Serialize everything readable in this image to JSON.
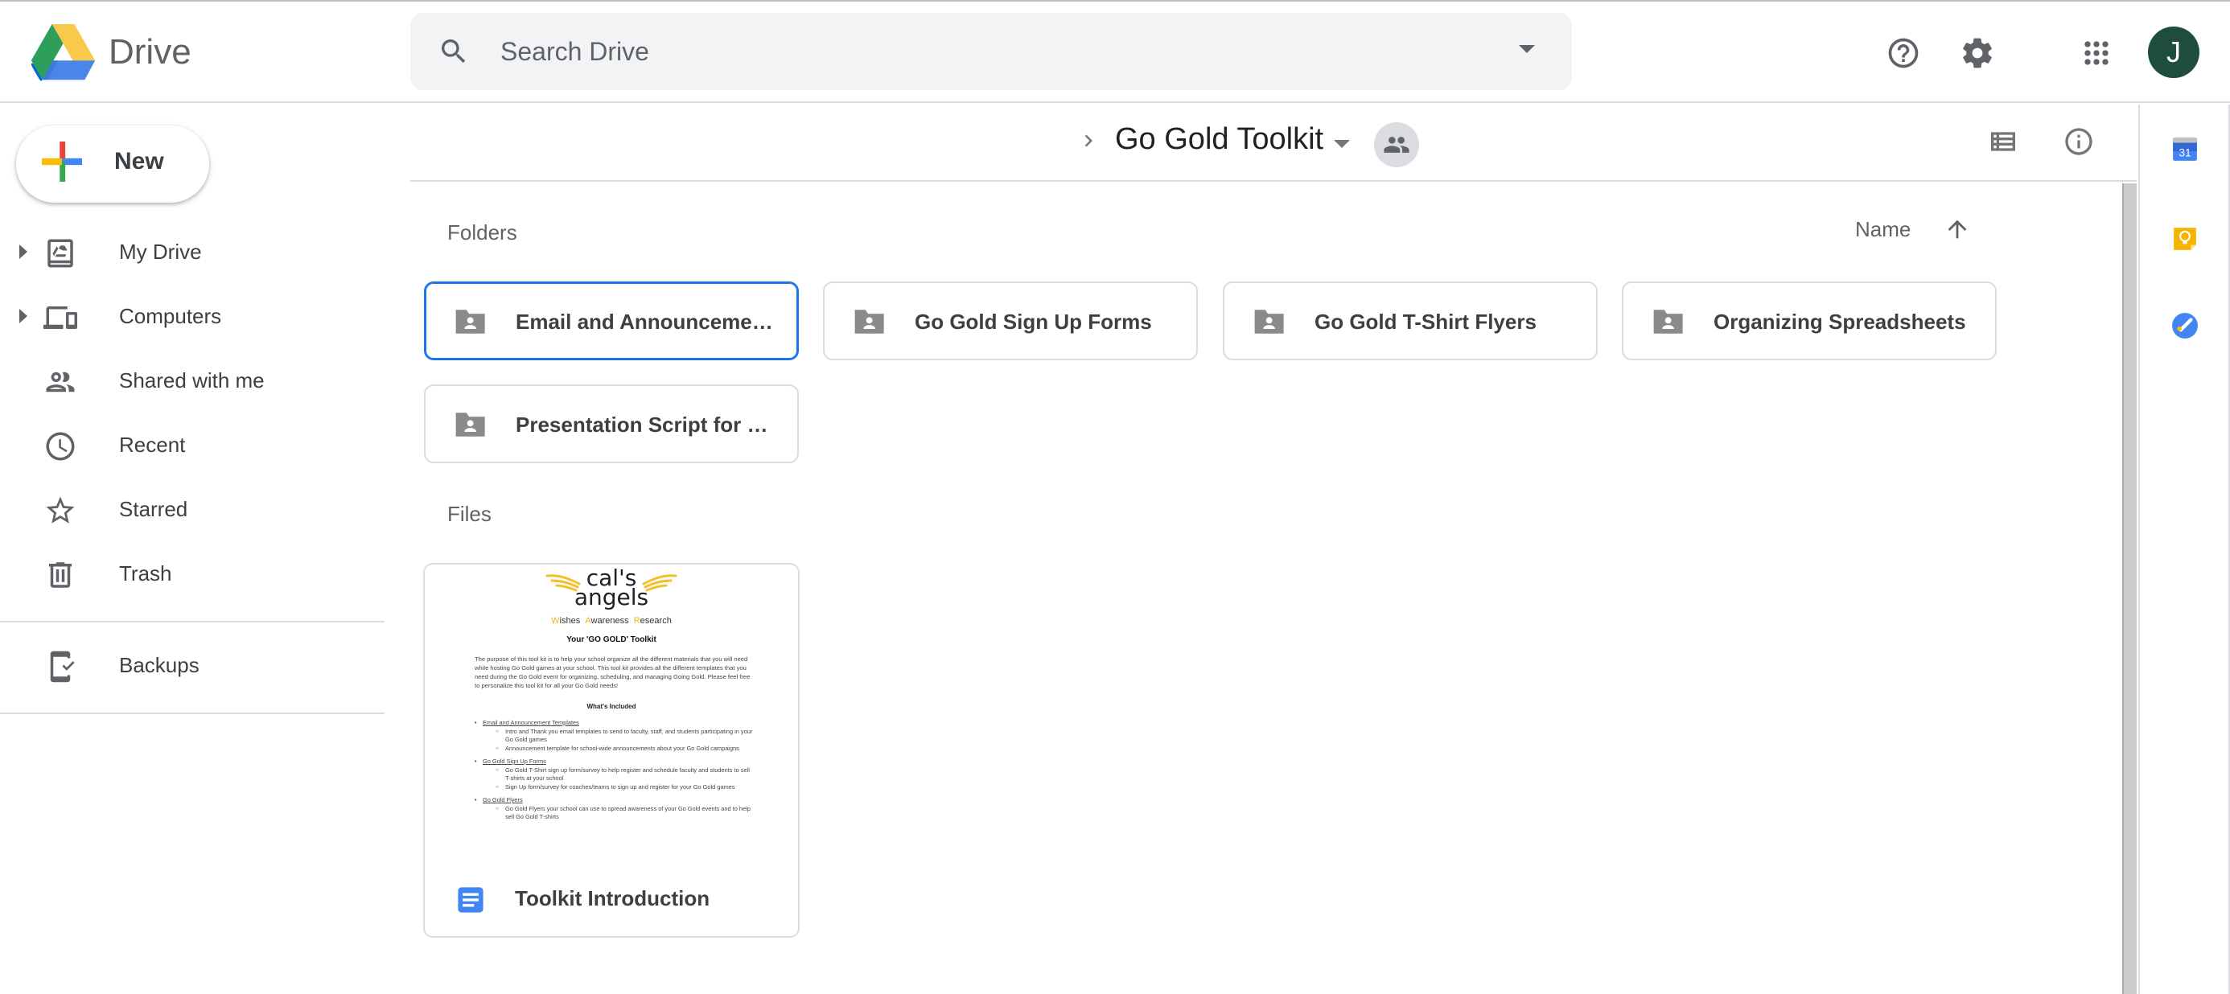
{
  "app": {
    "brand": "Drive",
    "colors": {
      "accent": "#1a73e8",
      "avatar_bg": "#1e4d40",
      "icon_gray": "#5f6368",
      "border": "#dadce0",
      "search_bg": "#f1f3f4"
    }
  },
  "header": {
    "search": {
      "placeholder": "Search Drive",
      "value": "",
      "icon": "search-icon",
      "options_icon": "caret-down-icon"
    },
    "actions": [
      {
        "name": "help",
        "icon": "help-circle-icon"
      },
      {
        "name": "settings",
        "icon": "gear-icon"
      },
      {
        "name": "apps",
        "icon": "apps-grid-icon"
      }
    ],
    "avatar_initial": "J"
  },
  "sidebar": {
    "new_label": "New",
    "items": [
      {
        "label": "My Drive",
        "icon": "my-drive-icon",
        "expandable": true
      },
      {
        "label": "Computers",
        "icon": "computers-icon",
        "expandable": true
      },
      {
        "label": "Shared with me",
        "icon": "people-icon",
        "expandable": false
      },
      {
        "label": "Recent",
        "icon": "clock-icon",
        "expandable": false
      },
      {
        "label": "Starred",
        "icon": "star-icon",
        "expandable": false
      },
      {
        "label": "Trash",
        "icon": "trash-icon",
        "expandable": false
      }
    ],
    "secondary_items": [
      {
        "label": "Backups",
        "icon": "backups-icon"
      }
    ]
  },
  "toolbar": {
    "breadcrumb": {
      "separator": "chevron-right-icon",
      "current": "Go Gold Toolkit",
      "shared_icon": "shared-folder-people-icon"
    },
    "view_toggle_icon": "list-view-icon",
    "details_icon": "info-icon"
  },
  "main": {
    "folders_label": "Folders",
    "files_label": "Files",
    "sort": {
      "label": "Name",
      "direction": "ascending"
    },
    "folders": [
      {
        "name": "Email and Announcement ...",
        "full_name_truncated": true,
        "selected": true
      },
      {
        "name": "Go Gold Sign Up Forms",
        "selected": false
      },
      {
        "name": "Go Gold T-Shirt Flyers",
        "selected": false
      },
      {
        "name": "Organizing Spreadsheets",
        "selected": false
      },
      {
        "name": "Presentation Script for Ga...",
        "full_name_truncated": true,
        "selected": false
      }
    ],
    "files": [
      {
        "name": "Toolkit Introduction",
        "type": "google-doc",
        "preview": {
          "logo_line1": "cal's",
          "logo_line2": "angels",
          "tagline": [
            {
              "initial": "W",
              "rest": "ishes"
            },
            {
              "initial": "A",
              "rest": "wareness"
            },
            {
              "initial": "R",
              "rest": "esearch"
            }
          ],
          "title": "Your 'GO GOLD' Toolkit",
          "paragraph": "The purpose of this tool kit is to help your school organize all the different materials that you will need while hosting Go Gold games at your school. This tool kit provides all the different templates that you need during the Go Gold event for organizing, scheduling, and managing Going Gold. Please feel free to personalize this tool kit for all your Go Gold needs!",
          "included_heading": "What's Included",
          "sections": [
            {
              "heading": "Email and Announcement Templates",
              "items": [
                "Intro and Thank you email templates to send to faculty, staff, and students participating in your Go Gold games",
                "Announcement template for school-wide announcements about your Go Gold campaigns"
              ]
            },
            {
              "heading": "Go Gold Sign Up Forms",
              "items": [
                "Go Gold T-Shirt sign up form/survey to help register and schedule faculty and students to sell T-shirts at your school",
                "Sign Up form/survey for coaches/teams to sign up and register for your Go Gold games"
              ]
            },
            {
              "heading": "Go Gold Flyers",
              "items": [
                "Go Gold Flyers your school can use to spread awareness of your Go Gold events and to help sell Go Gold T-shirts"
              ]
            }
          ]
        }
      }
    ]
  },
  "side_panel": {
    "apps": [
      {
        "name": "Calendar",
        "icon": "calendar-icon",
        "badge": "31"
      },
      {
        "name": "Keep",
        "icon": "keep-icon"
      },
      {
        "name": "Tasks",
        "icon": "tasks-icon"
      }
    ]
  }
}
